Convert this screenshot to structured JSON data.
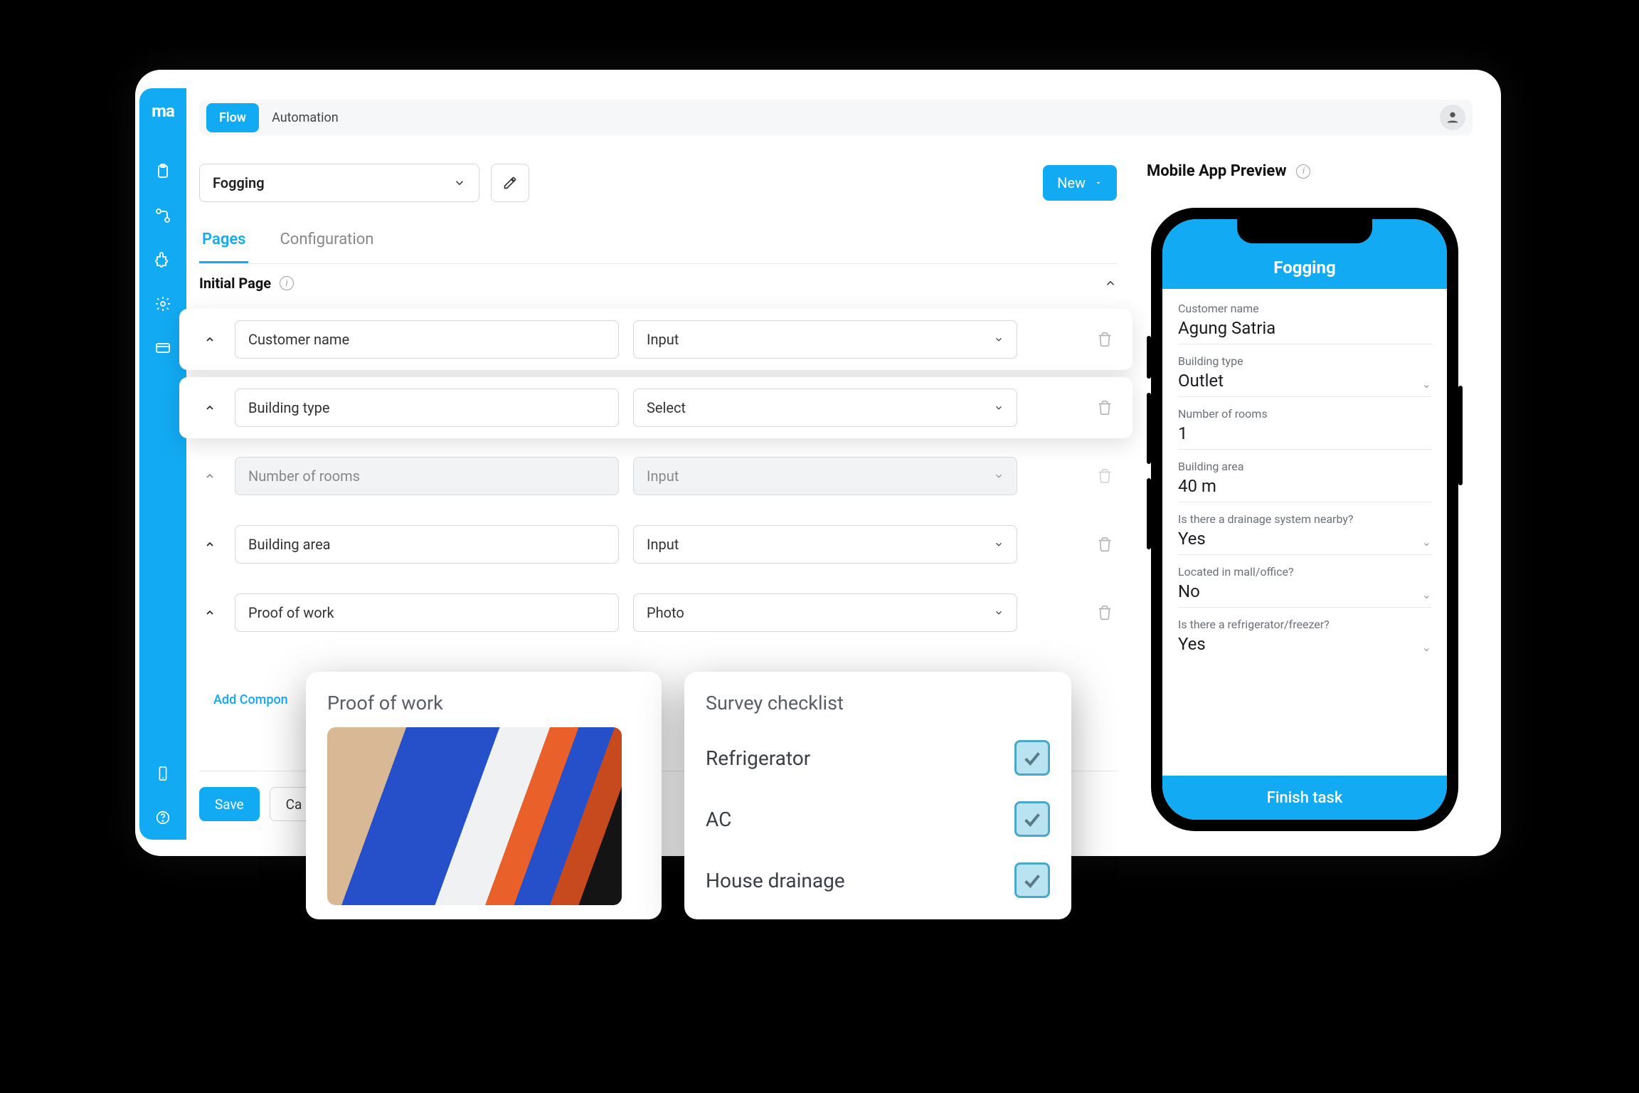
{
  "topbar": {
    "tab_flow": "Flow",
    "tab_automation": "Automation"
  },
  "toolbar": {
    "workflow_name": "Fogging",
    "new_label": "New"
  },
  "subtabs": {
    "pages": "Pages",
    "configuration": "Configuration"
  },
  "section": {
    "title": "Initial Page"
  },
  "rows": [
    {
      "name": "Customer name",
      "type": "Input"
    },
    {
      "name": "Building type",
      "type": "Select"
    },
    {
      "name": "Number of rooms",
      "type": "Input"
    },
    {
      "name": "Building area",
      "type": "Input"
    },
    {
      "name": "Proof of work",
      "type": "Photo"
    }
  ],
  "add_component": "Add Compon",
  "footer": {
    "save": "Save",
    "cancel": "Ca"
  },
  "preview": {
    "title": "Mobile App Preview"
  },
  "phone": {
    "title": "Fogging",
    "fields": [
      {
        "label": "Customer name",
        "value": "Agung Satria",
        "chev": false
      },
      {
        "label": "Building type",
        "value": "Outlet",
        "chev": true
      },
      {
        "label": "Number of rooms",
        "value": "1",
        "chev": false
      },
      {
        "label": "Building area",
        "value": "40 m",
        "chev": false
      },
      {
        "label": "Is there a drainage system nearby?",
        "value": "Yes",
        "chev": true
      },
      {
        "label": "Located in mall/office?",
        "value": "No",
        "chev": true
      },
      {
        "label": "Is there a refrigerator/freezer?",
        "value": "Yes",
        "chev": true
      }
    ],
    "cta": "Finish task"
  },
  "pop_proof": {
    "title": "Proof of work"
  },
  "pop_checklist": {
    "title": "Survey checklist",
    "items": [
      "Refrigerator",
      "AC",
      "House drainage"
    ]
  }
}
